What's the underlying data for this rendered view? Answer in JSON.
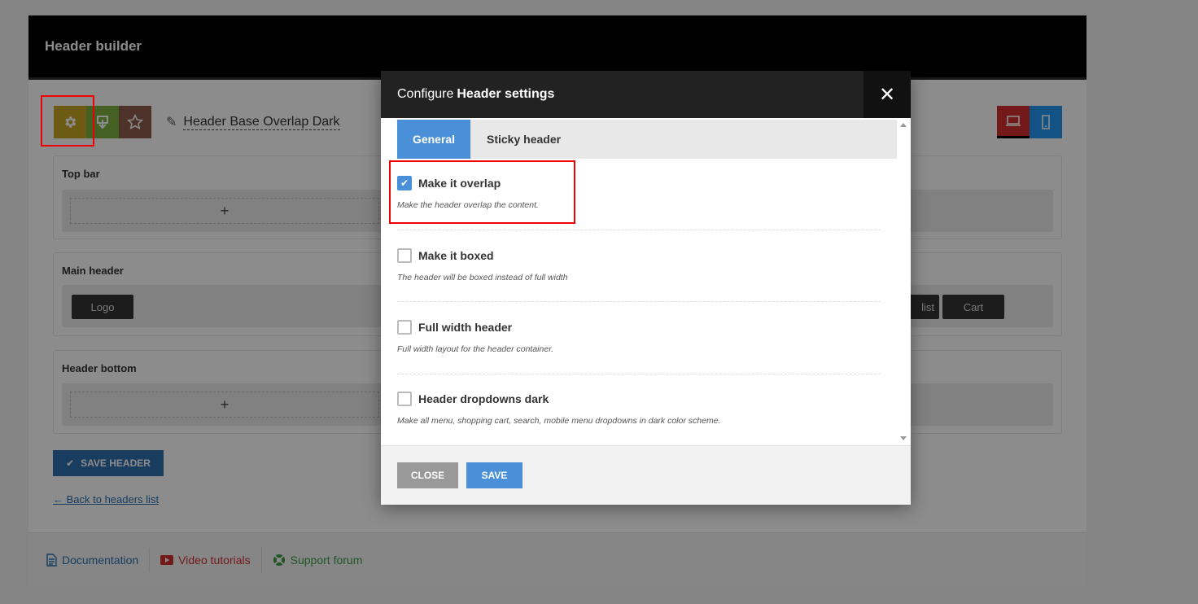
{
  "panel": {
    "title": "Header builder",
    "header_name": "Header Base Overlap Dark",
    "sections": [
      {
        "label": "Top bar",
        "add": "+"
      },
      {
        "label": "Main header",
        "logo": "Logo",
        "partial": "list",
        "cart": "Cart"
      },
      {
        "label": "Header bottom",
        "add": "+"
      }
    ],
    "save_label": "SAVE HEADER",
    "back_link": "← Back to headers list",
    "footer": {
      "documentation": "Documentation",
      "video": "Video tutorials",
      "support": "Support forum"
    }
  },
  "modal": {
    "title_prefix": "Configure",
    "title_bold": "Header settings",
    "close_x": "✕",
    "tabs": [
      {
        "label": "General",
        "active": true
      },
      {
        "label": "Sticky header",
        "active": false
      }
    ],
    "options": [
      {
        "label": "Make it overlap",
        "desc": "Make the header overlap the content.",
        "checked": true
      },
      {
        "label": "Make it boxed",
        "desc": "The header will be boxed instead of full width",
        "checked": false
      },
      {
        "label": "Full width header",
        "desc": "Full width layout for the header container.",
        "checked": false
      },
      {
        "label": "Header dropdowns dark",
        "desc": "Make all menu, shopping cart, search, mobile menu dropdowns in dark color scheme.",
        "checked": false
      }
    ],
    "close_label": "CLOSE",
    "save_label": "SAVE"
  },
  "colors": {
    "accent": "#4a90d9",
    "highlight": "#e00000"
  }
}
